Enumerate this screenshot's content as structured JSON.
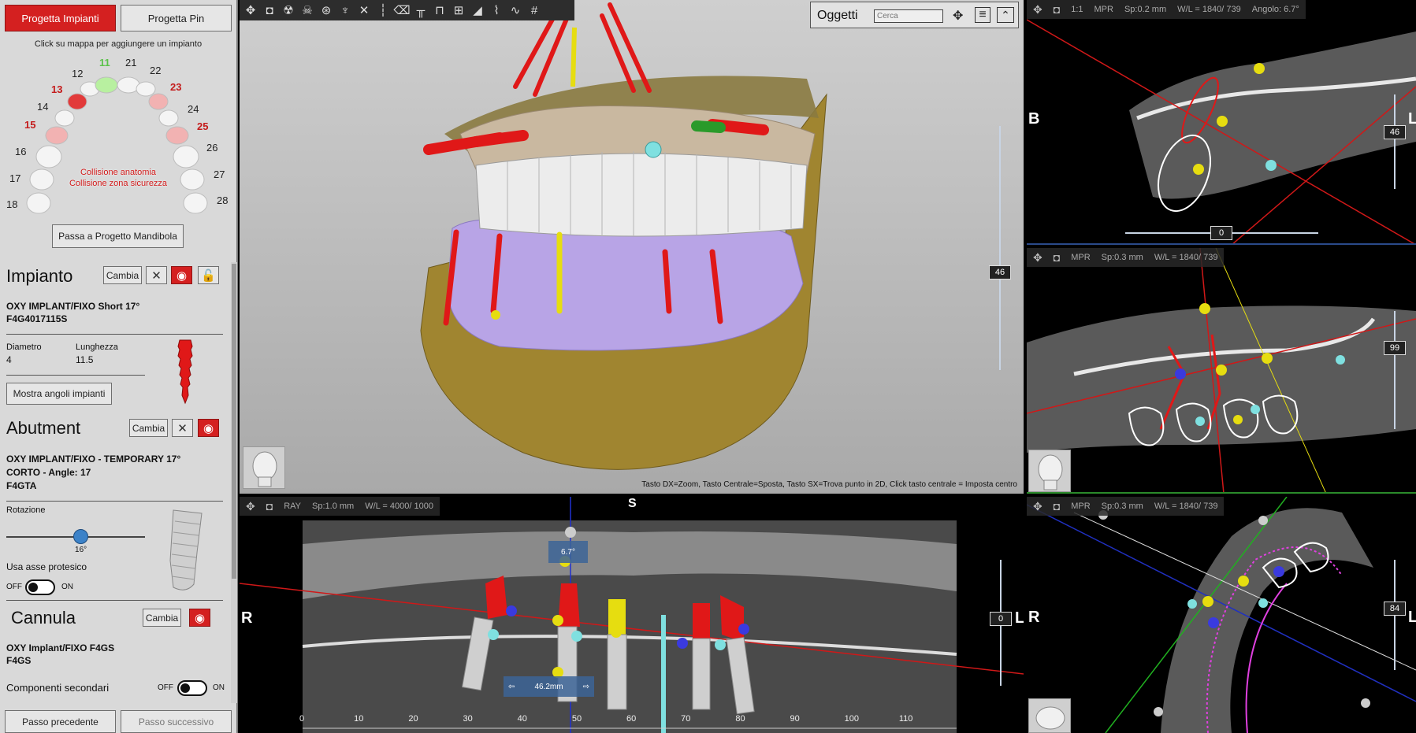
{
  "left_panel": {
    "tabs": {
      "impianti": "Progetta Impianti",
      "pin": "Progetta Pin"
    },
    "map_hint": "Click su mappa per aggiungere un impianto",
    "tooth_numbers": {
      "t11": "11",
      "t12": "12",
      "t13": "13",
      "t14": "14",
      "t15": "15",
      "t16": "16",
      "t17": "17",
      "t18": "18",
      "t21": "21",
      "t22": "22",
      "t23": "23",
      "t24": "24",
      "t25": "25",
      "t26": "26",
      "t27": "27",
      "t28": "28"
    },
    "collision_legend": {
      "anatomy": "Collisione anatomia",
      "safety": "Collisione zona sicurezza"
    },
    "mandible_button": "Passa a Progetto Mandibola",
    "implant": {
      "title": "Impianto",
      "change": "Cambia",
      "model": "OXY IMPLANT/FIXO Short 17°",
      "code": "F4G4017115S",
      "diameter_label": "Diametro",
      "diameter_value": "4",
      "length_label": "Lunghezza",
      "length_value": "11.5",
      "angles_button": "Mostra angoli impianti"
    },
    "abutment": {
      "title": "Abutment",
      "change": "Cambia",
      "model_line1": "OXY IMPLANT/FIXO - TEMPORARY 17°",
      "model_line2": "CORTO - Angle: 17",
      "code": "F4GTA",
      "rotation_label": "Rotazione",
      "rotation_value": "16°",
      "rotation_fraction": 0.54,
      "prosthetic_axis_label": "Usa asse protesico",
      "off": "OFF",
      "on": "ON"
    },
    "cannula": {
      "title": "Cannula",
      "change": "Cambia",
      "model": "OXY Implant/FIXO F4GS",
      "code": "F4GS"
    },
    "secondary": {
      "label": "Componenti secondari",
      "off": "OFF",
      "on": "ON"
    },
    "nav": {
      "prev": "Passo precedente",
      "next": "Passo successivo"
    }
  },
  "view3d": {
    "objects_title": "Oggetti",
    "search_placeholder": "Cerca",
    "hint": "Tasto DX=Zoom, Tasto Centrale=Sposta, Tasto SX=Trova punto in 2D, Click tasto centrale = Imposta centro",
    "slider_value": "46"
  },
  "view_top_right": {
    "zoom": "1:1",
    "mode": "MPR",
    "spacing": "Sp:0.2 mm",
    "window": "W/L = 1840/ 739",
    "angle": "Angolo: 6.7°",
    "side_left": "B",
    "side_right": "L",
    "slider_value": "46",
    "h_value": "0"
  },
  "view_mid_right": {
    "mode": "MPR",
    "spacing": "Sp:0.3 mm",
    "window": "W/L = 1840/ 739",
    "slider_value": "99"
  },
  "view_bottom_right": {
    "mode": "MPR",
    "spacing": "Sp:0.3 mm",
    "window": "W/L = 1840/ 739",
    "side_left": "R",
    "side_right": "L",
    "slider_value": "84"
  },
  "view_pano": {
    "mode": "RAY",
    "spacing": "Sp:1.0 mm",
    "window": "W/L = 4000/ 1000",
    "side_top": "S",
    "side_left": "R",
    "side_right": "L",
    "slider_value": "0",
    "angle_label": "6.7°",
    "distance_label": "46.2mm",
    "ruler_ticks": [
      "0",
      "10",
      "20",
      "30",
      "40",
      "50",
      "60",
      "70",
      "80",
      "90",
      "100",
      "110"
    ]
  },
  "colors": {
    "accent_red": "#d42020",
    "selected_tooth": "#b8f0a0",
    "implant_yellow": "#e6dd10",
    "implant_cyan": "#7fe0e0"
  }
}
